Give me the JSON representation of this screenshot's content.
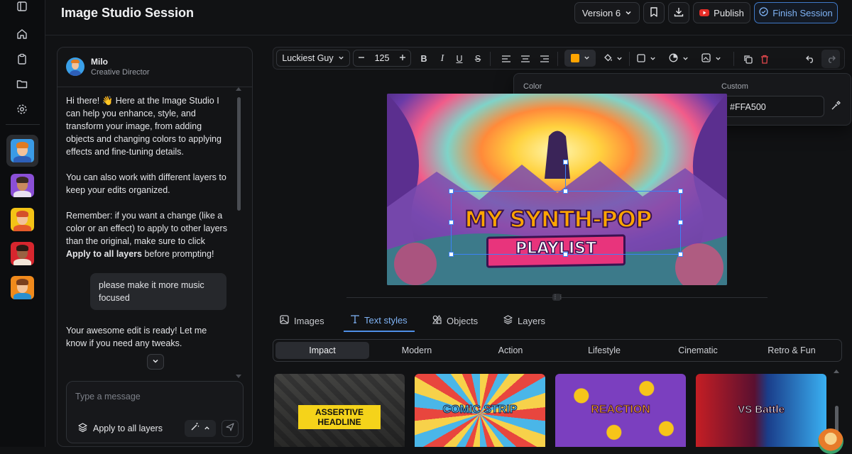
{
  "header": {
    "title": "Image Studio Session",
    "version_label": "Version 6",
    "publish_label": "Publish",
    "finish_label": "Finish Session"
  },
  "rail": {
    "nav_icons": [
      "sidebar-toggle-icon",
      "home-icon",
      "clipboard-icon",
      "folder-icon",
      "settings-icon"
    ],
    "avatars": [
      "milo",
      "purple",
      "sunflower",
      "red",
      "orange"
    ]
  },
  "chat": {
    "agent_name": "Milo",
    "agent_role": "Creative Director",
    "messages": [
      {
        "from": "agent",
        "text": "Hi there! 👋 Here at the Image Studio I can help you enhance, style, and transform your image, from adding objects and changing colors to applying effects and fine-tuning details."
      },
      {
        "from": "agent",
        "text": "You can also work with different layers to keep your edits organized."
      },
      {
        "from": "agent",
        "text_before": "Remember: if you want a change (like a color or an effect) to apply to other layers than the original, make sure to click ",
        "text_bold": "Apply to all layers",
        "text_after": " before prompting!"
      },
      {
        "from": "user",
        "text": "please make it more music focused"
      },
      {
        "from": "agent",
        "text": "Your awesome edit is ready! Let me know if you need any tweaks."
      }
    ],
    "input_placeholder": "Type a message",
    "apply_all_label": "Apply to all layers"
  },
  "toolbar": {
    "font": "Luckiest Guy",
    "font_size": "125",
    "active_color": "#FFA500"
  },
  "color_popover": {
    "color_label": "Color",
    "custom_label": "Custom",
    "custom_value": "#FFA500",
    "swatches": [
      "#FFFFFF",
      "#000000",
      "#F5C518",
      "#F07C1A",
      "#E8232A",
      "#E0407E",
      "#8B45C9",
      "#1E90F0",
      "#9BD12E"
    ]
  },
  "canvas": {
    "headline": "MY SYNTH-POP",
    "banner": "PLAYLIST"
  },
  "panel_tabs": [
    "Images",
    "Text styles",
    "Objects",
    "Layers"
  ],
  "active_tab": "Text styles",
  "style_categories": [
    "Impact",
    "Modern",
    "Action",
    "Lifestyle",
    "Cinematic",
    "Retro & Fun"
  ],
  "active_category": "Impact",
  "style_cards": [
    "ASSERTIVE HEADLINE",
    "COMIC STRIP",
    "REACTION",
    "VS Battle"
  ],
  "colors": {
    "accent": "#4F8FE6",
    "publish_icon": "#E52D27",
    "delete": "#E5484D"
  }
}
